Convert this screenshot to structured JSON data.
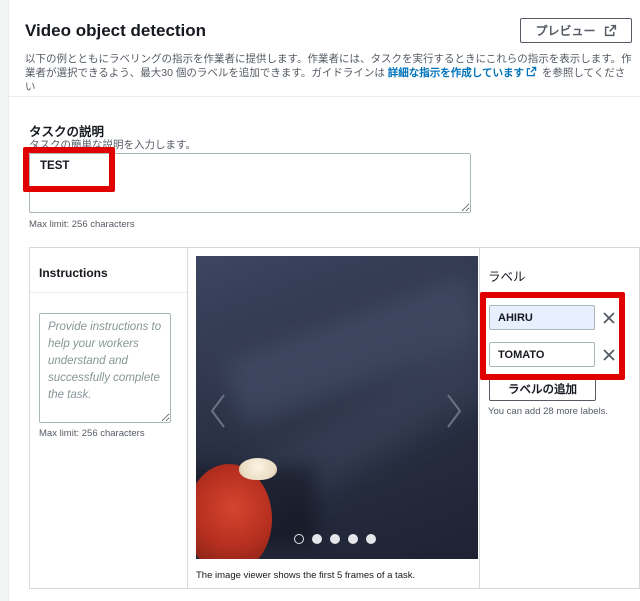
{
  "header": {
    "title": "Video object detection",
    "preview_label": "プレビュー",
    "description_text": "以下の例とともにラベリングの指示を作業者に提供します。作業者には、タスクを実行するときにこれらの指示を表示します。作業者が選択できるよう、最大30 個のラベルを追加できます。ガイドラインは ",
    "description_link": "詳細な指示を作成しています",
    "description_suffix": " を参照してください"
  },
  "task": {
    "label": "タスクの説明",
    "help": "タスクの簡単な説明を入力します。",
    "value": "TEST",
    "limit": "Max limit: 256 characters"
  },
  "instructions": {
    "title": "Instructions",
    "placeholder": "Provide instructions to help your workers understand and successfully complete the task.",
    "limit": "Max limit: 256 characters"
  },
  "viewer": {
    "caption": "The image viewer shows the first 5 frames of a task.",
    "frame_count": 5,
    "active_frame": 1
  },
  "labels": {
    "title": "ラベル",
    "items": [
      {
        "value": "AHIRU"
      },
      {
        "value": "TOMATO"
      }
    ],
    "add_label": "ラベルの追加",
    "note": "You can add 28 more labels."
  },
  "colors": {
    "highlight": "#e00000",
    "link": "#0073bb",
    "focused_input": "#e8efff"
  }
}
